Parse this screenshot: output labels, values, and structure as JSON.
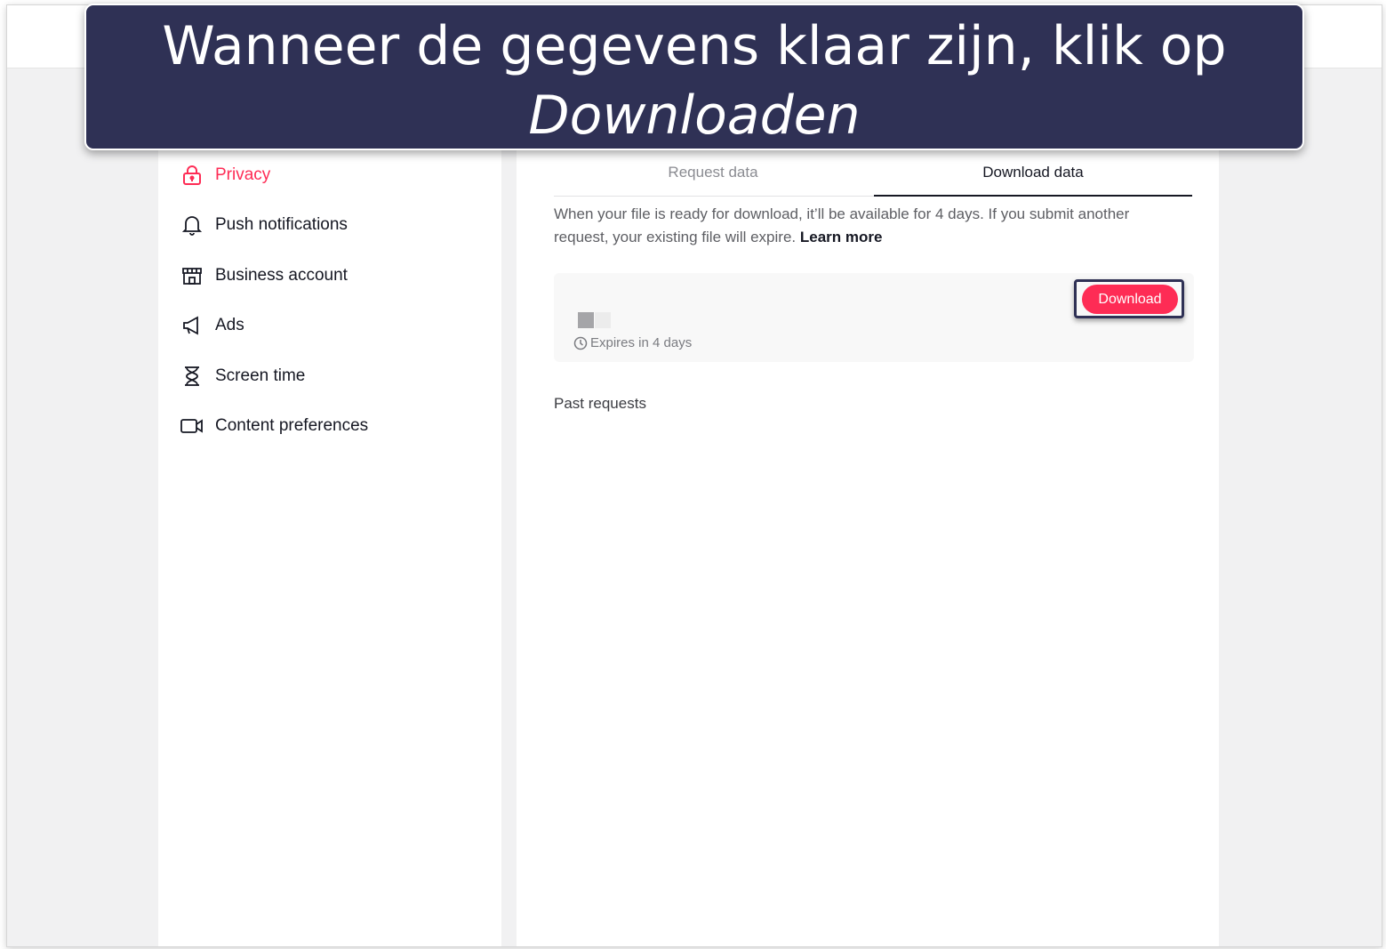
{
  "banner": {
    "line1": "Wanneer de gegevens klaar zijn, klik op",
    "line2": "Downloaden"
  },
  "sidebar": {
    "items": [
      {
        "label": "Privacy",
        "icon": "lock-icon",
        "active": true
      },
      {
        "label": "Push notifications",
        "icon": "bell-icon",
        "active": false
      },
      {
        "label": "Business account",
        "icon": "store-icon",
        "active": false
      },
      {
        "label": "Ads",
        "icon": "megaphone-icon",
        "active": false
      },
      {
        "label": "Screen time",
        "icon": "hourglass-icon",
        "active": false
      },
      {
        "label": "Content preferences",
        "icon": "video-icon",
        "active": false
      }
    ]
  },
  "tabs": {
    "request": "Request data",
    "download": "Download data"
  },
  "description": {
    "text": "When your file is ready for download, it’ll be available for 4 days. If you submit another request, your existing file will expire.",
    "link": "Learn more"
  },
  "file": {
    "expires": "Expires in 4 days",
    "download_label": "Download"
  },
  "past_requests": "Past requests",
  "colors": {
    "accent": "#fe2c55",
    "banner": "#2f3155",
    "text": "#161823"
  }
}
